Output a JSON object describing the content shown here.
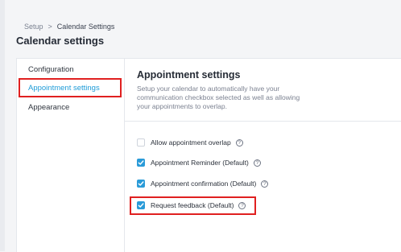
{
  "breadcrumb": {
    "parent": "Setup",
    "separator": ">",
    "current": "Calendar Settings"
  },
  "page_title": "Calendar settings",
  "nav": {
    "items": [
      {
        "label": "Configuration",
        "active": false
      },
      {
        "label": "Appointment settings",
        "active": true
      },
      {
        "label": "Appearance",
        "active": false
      }
    ]
  },
  "section": {
    "title": "Appointment settings",
    "description": "Setup your calendar to automatically have your communication checkbox selected as well as allowing your appointments to overlap."
  },
  "options": [
    {
      "label": "Allow appointment overlap",
      "checked": false
    },
    {
      "label": "Appointment Reminder (Default)",
      "checked": true
    },
    {
      "label": "Appointment confirmation (Default)",
      "checked": true
    },
    {
      "label": "Request feedback (Default)",
      "checked": true
    }
  ],
  "icons": {
    "help": "help-circle-icon",
    "check": "checkmark-icon"
  },
  "colors": {
    "accent": "#2a9bd8",
    "active_nav": "#1e9bd7",
    "highlight": "#e02020"
  }
}
